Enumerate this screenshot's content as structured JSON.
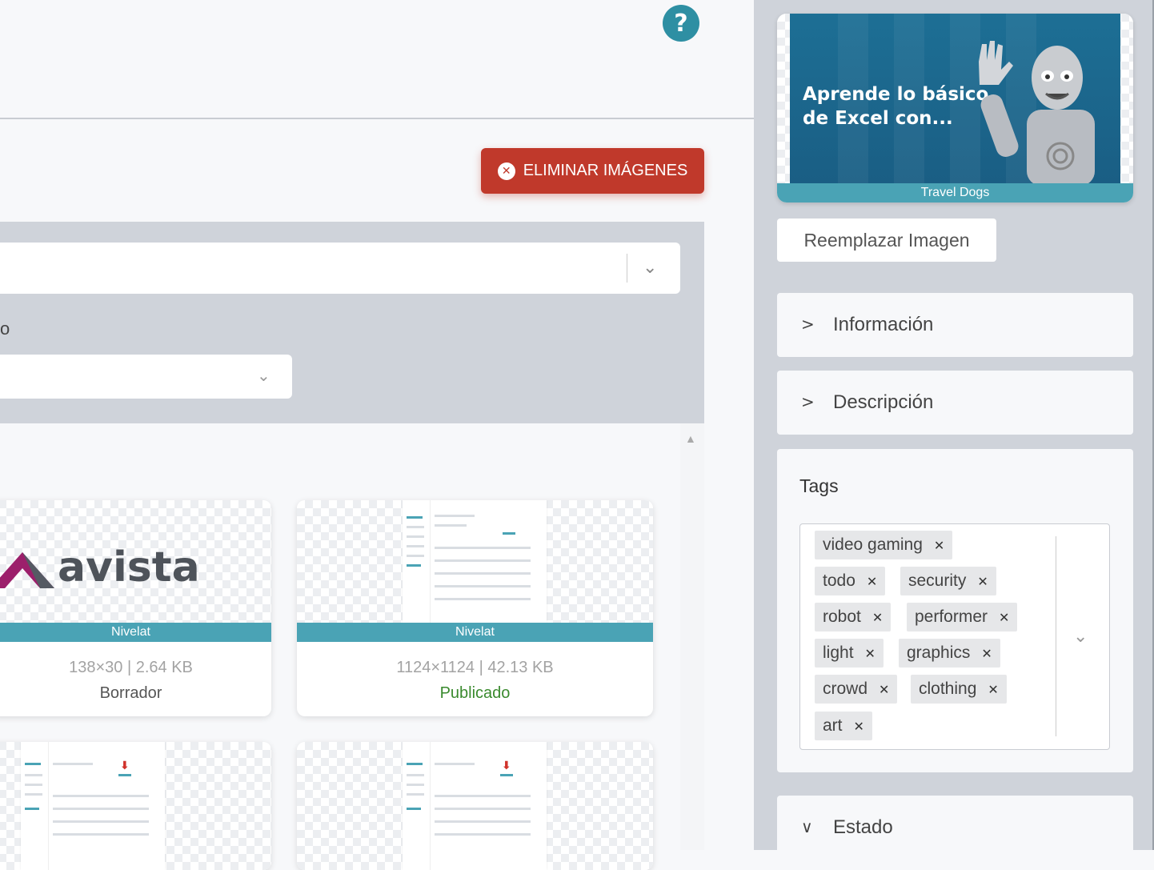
{
  "header": {
    "help_icon_glyph": "?"
  },
  "toolbar": {
    "delete_label": "ELIMINAR IMÁGENES",
    "delete_icon_glyph": "✕"
  },
  "filters": {
    "select_1_chevron": "⌄",
    "label_fragment": "o",
    "select_2_chevron": "⌄"
  },
  "grid": {
    "cards": [
      {
        "logo_text": "avista",
        "band": "Nivelat",
        "dims": "138×30 | 2.64 KB",
        "status": "Borrador",
        "status_color": "#555555"
      },
      {
        "band": "Nivelat",
        "dims": "1124×1124 | 42.13 KB",
        "status": "Publicado",
        "status_color": "#3a8a2e"
      }
    ],
    "scroll_up_glyph": "▲"
  },
  "sidebar": {
    "preview": {
      "text_line1": "Aprende lo básico",
      "text_line2": "de Excel con...",
      "band": "Travel Dogs"
    },
    "replace_label": "Reemplazar Imagen",
    "sections": {
      "info": {
        "label": "Información",
        "chevron": ">"
      },
      "description": {
        "label": "Descripción",
        "chevron": ">"
      },
      "estado": {
        "label": "Estado",
        "chevron": "∨"
      }
    },
    "tags": {
      "title": "Tags",
      "items": [
        "video gaming",
        "todo",
        "security",
        "robot",
        "performer",
        "light",
        "graphics",
        "crowd",
        "clothing",
        "art"
      ],
      "remove_glyph": "✕",
      "dropdown_chevron": "⌄"
    }
  },
  "colors": {
    "accent": "#4aa3b5",
    "danger": "#c0392b",
    "help": "#2e8fa3"
  }
}
